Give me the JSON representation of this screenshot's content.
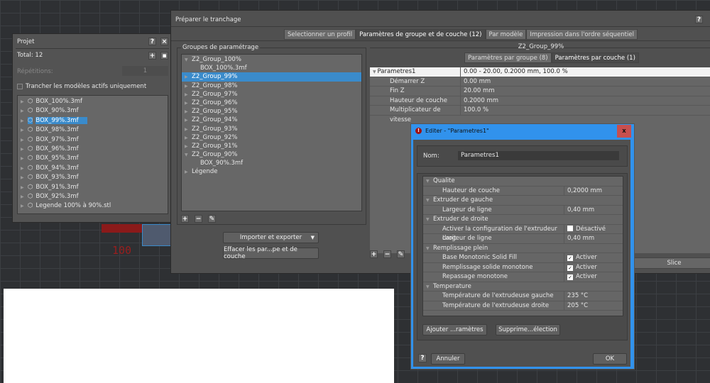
{
  "project": {
    "title": "Projet",
    "total": "Total: 12",
    "repetitions_label": "Répétitions:",
    "repetitions_value": "1",
    "active_only_label": "Trancher les modèles actifs uniquement",
    "models": [
      "BOX_100%.3mf",
      "BOX_90%.3mf",
      "BOX_99%.3mf",
      "BOX_98%.3mf",
      "BOX_97%.3mf",
      "BOX_96%.3mf",
      "BOX_95%.3mf",
      "BOX_94%.3mf",
      "BOX_93%.3mf",
      "BOX_91%.3mf",
      "BOX_92%.3mf",
      "Legende 100% à 90%.stl"
    ],
    "selected_index": 2
  },
  "prepare": {
    "title": "Préparer le tranchage",
    "tabs": [
      "Selectionner un profil",
      "Paramètres de groupe et de couche (12)",
      "Par modèle",
      "Impression dans l'ordre séquentiel"
    ],
    "active_tab": 1,
    "groups_title": "Groupes de paramétrage",
    "groups": [
      {
        "label": "Z2_Group_100%",
        "level": 0,
        "open": true
      },
      {
        "label": "BOX_100%.3mf",
        "level": 1
      },
      {
        "label": "Z2_Group_99%",
        "level": 0,
        "selected": true
      },
      {
        "label": "Z2_Group_98%",
        "level": 0
      },
      {
        "label": "Z2_Group_97%",
        "level": 0
      },
      {
        "label": "Z2_Group_96%",
        "level": 0
      },
      {
        "label": "Z2_Group_95%",
        "level": 0
      },
      {
        "label": "Z2_Group_94%",
        "level": 0
      },
      {
        "label": "Z2_Group_93%",
        "level": 0
      },
      {
        "label": "Z2_Group_92%",
        "level": 0
      },
      {
        "label": "Z2_Group_91%",
        "level": 0
      },
      {
        "label": "Z2_Group_90%",
        "level": 0,
        "open": true
      },
      {
        "label": "BOX_90%.3mf",
        "level": 1
      },
      {
        "label": "Légende",
        "level": 0
      }
    ],
    "import_export": "Importer et exporter",
    "clear_button": "Effacer les par...pe et de couche",
    "group_name": "Z2_Group_99%",
    "subtabs": [
      "Paramètres par groupe (8)",
      "Paramètres par couche (1)"
    ],
    "layer_params": {
      "name": "Parametres1",
      "summary": "0.00 - 20.00, 0.2000 mm, 100.0 %",
      "rows": [
        [
          "Démarrer Z",
          "0.00 mm"
        ],
        [
          "Fin Z",
          "20.00 mm"
        ],
        [
          "Hauteur de couche",
          "0.2000 mm"
        ],
        [
          "Multiplicateur de vitesse",
          "100.0 %"
        ]
      ]
    },
    "slice_button": "Slice"
  },
  "edit": {
    "title": "Editer - \"Parametres1\"",
    "name_label": "Nom:",
    "name_value": "Parametres1",
    "sections": [
      {
        "title": "Qualite",
        "rows": [
          {
            "k": "Hauteur de couche",
            "v": "0,2000 mm"
          }
        ]
      },
      {
        "title": "Extruder de gauche",
        "rows": [
          {
            "k": "Largeur de ligne",
            "v": "0,40 mm"
          }
        ]
      },
      {
        "title": "Extruder de droite",
        "rows": [
          {
            "k": "Activer la configuration de l'extrudeur droit",
            "v": "Désactivé",
            "cb": false
          },
          {
            "k": "Largeur de ligne",
            "v": "0,40 mm"
          }
        ]
      },
      {
        "title": "Remplissage plein",
        "rows": [
          {
            "k": "Base Monotonic Solid Fill",
            "v": "Activer",
            "cb": true
          },
          {
            "k": "Remplissage solide monotone",
            "v": "Activer",
            "cb": true
          },
          {
            "k": "Repassage monotone",
            "v": "Activer",
            "cb": true
          }
        ]
      },
      {
        "title": "Temperature",
        "rows": [
          {
            "k": "Température de l'extrudeuse gauche",
            "v": "235 °C"
          },
          {
            "k": "Température de l'extrudeuse droite",
            "v": "205 °C"
          }
        ]
      }
    ],
    "add_button": "Ajouter ...ramètres",
    "remove_button": "Supprime...élection",
    "cancel_button": "Annuler",
    "ok_button": "OK",
    "help": "?"
  },
  "viewport": {
    "label_100": "100"
  }
}
